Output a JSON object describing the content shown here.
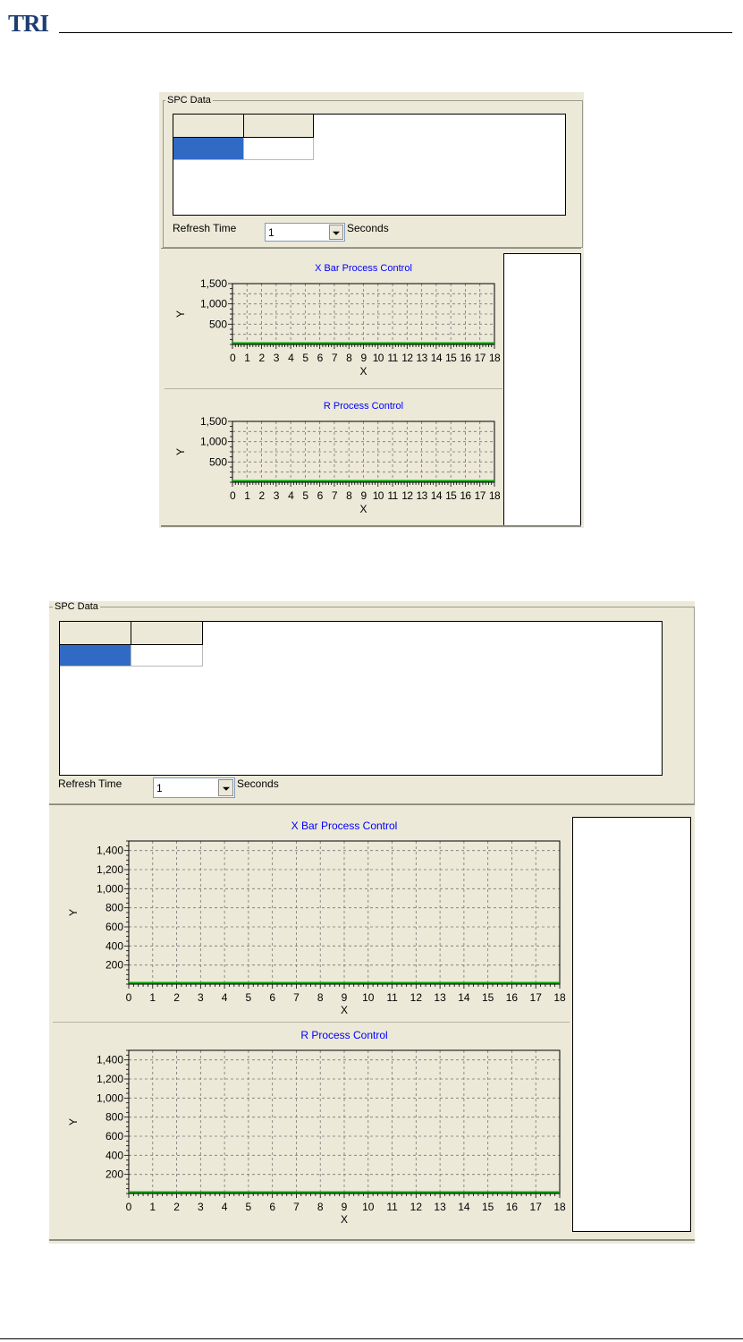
{
  "header": {
    "logo_text": "TRI"
  },
  "screens": [
    {
      "group_title": "SPC Data",
      "refresh_label": "Refresh Time",
      "refresh_value": "1",
      "refresh_unit": "Seconds",
      "charts": [
        {
          "title": "X Bar Process Control",
          "xlabel": "X",
          "ylabel": "Y"
        },
        {
          "title": "R Process Control",
          "xlabel": "X",
          "ylabel": "Y"
        }
      ]
    },
    {
      "group_title": "SPC Data",
      "refresh_label": "Refresh Time",
      "refresh_value": "1",
      "refresh_unit": "Seconds",
      "charts": [
        {
          "title": "X Bar Process Control",
          "xlabel": "X",
          "ylabel": "Y"
        },
        {
          "title": "R Process Control",
          "xlabel": "X",
          "ylabel": "Y"
        }
      ]
    }
  ],
  "colors": {
    "title_blue": "#0000ff",
    "line_green": "#00aa00",
    "selection_blue": "#316ac5",
    "panel_bg": "#ece9d8"
  },
  "chart_data": [
    {
      "type": "line",
      "title": "X Bar Process Control",
      "xlabel": "X",
      "ylabel": "Y",
      "xlim": [
        0,
        18
      ],
      "ylim": [
        0,
        1500
      ],
      "x_ticks": [
        0,
        1,
        2,
        3,
        4,
        5,
        6,
        7,
        8,
        9,
        10,
        11,
        12,
        13,
        14,
        15,
        16,
        17,
        18
      ],
      "y_ticks": [
        500,
        1000,
        1500
      ],
      "y_tick_labels": [
        "500",
        "1,000",
        "1,500"
      ],
      "grid": true,
      "series": [
        {
          "x": [
            0,
            18
          ],
          "y": [
            0,
            0
          ]
        }
      ]
    },
    {
      "type": "line",
      "title": "R Process Control",
      "xlabel": "X",
      "ylabel": "Y",
      "xlim": [
        0,
        18
      ],
      "ylim": [
        0,
        1500
      ],
      "x_ticks": [
        0,
        1,
        2,
        3,
        4,
        5,
        6,
        7,
        8,
        9,
        10,
        11,
        12,
        13,
        14,
        15,
        16,
        17,
        18
      ],
      "y_ticks": [
        500,
        1000,
        1500
      ],
      "y_tick_labels": [
        "500",
        "1,000",
        "1,500"
      ],
      "grid": true,
      "series": [
        {
          "x": [
            0,
            18
          ],
          "y": [
            0,
            0
          ]
        }
      ]
    },
    {
      "type": "line",
      "title": "X Bar Process Control",
      "xlabel": "X",
      "ylabel": "Y",
      "xlim": [
        0,
        18
      ],
      "ylim": [
        0,
        1500
      ],
      "x_ticks": [
        0,
        1,
        2,
        3,
        4,
        5,
        6,
        7,
        8,
        9,
        10,
        11,
        12,
        13,
        14,
        15,
        16,
        17,
        18
      ],
      "y_ticks": [
        200,
        400,
        600,
        800,
        1000,
        1200,
        1400
      ],
      "y_tick_labels": [
        "200",
        "400",
        "600",
        "800",
        "1,000",
        "1,200",
        "1,400"
      ],
      "grid": true,
      "series": [
        {
          "x": [
            0,
            18
          ],
          "y": [
            0,
            0
          ]
        }
      ]
    },
    {
      "type": "line",
      "title": "R Process Control",
      "xlabel": "X",
      "ylabel": "Y",
      "xlim": [
        0,
        18
      ],
      "ylim": [
        0,
        1500
      ],
      "x_ticks": [
        0,
        1,
        2,
        3,
        4,
        5,
        6,
        7,
        8,
        9,
        10,
        11,
        12,
        13,
        14,
        15,
        16,
        17,
        18
      ],
      "y_ticks": [
        200,
        400,
        600,
        800,
        1000,
        1200,
        1400
      ],
      "y_tick_labels": [
        "200",
        "400",
        "600",
        "800",
        "1,000",
        "1,200",
        "1,400"
      ],
      "grid": true,
      "series": [
        {
          "x": [
            0,
            18
          ],
          "y": [
            0,
            0
          ]
        }
      ]
    }
  ]
}
